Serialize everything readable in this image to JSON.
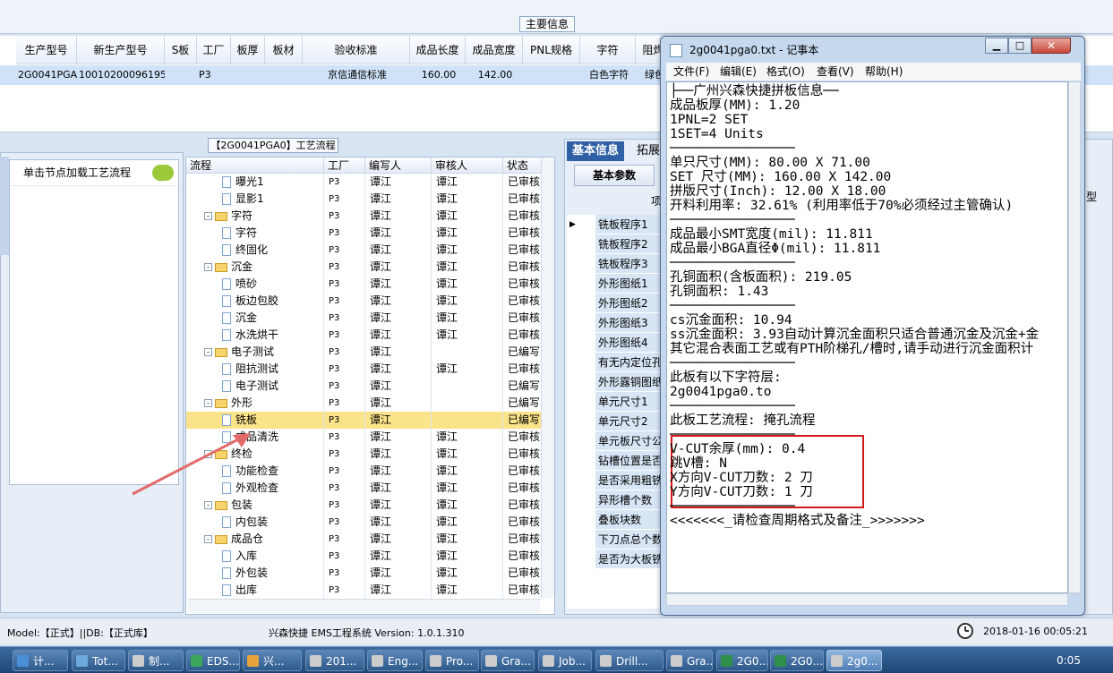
{
  "main_info": {
    "title": "主要信息",
    "columns": [
      "生产型号",
      "新生产型号",
      "S板",
      "工厂",
      "板厚",
      "板材",
      "验收标准",
      "成品长度",
      "成品宽度",
      "PNL规格",
      "字符",
      "阻焊"
    ],
    "row": [
      "2G0041PGA0",
      "10010200096195",
      "",
      "P3",
      "",
      "",
      "京信通信标准",
      "160.00",
      "142.00",
      "",
      "白色字符",
      "绿色"
    ]
  },
  "left_panel": {
    "load_button": "单击节点加载工艺流程"
  },
  "process": {
    "title": "【2G0041PGA0】工艺流程",
    "columns": [
      "流程",
      "工厂",
      "编写人",
      "审核人",
      "状态"
    ],
    "rows": [
      {
        "name": "曝光1",
        "level": 2,
        "factory": "P3",
        "writer": "谭江",
        "reviewer": "谭江",
        "status": "已审核"
      },
      {
        "name": "显影1",
        "level": 2,
        "factory": "P3",
        "writer": "谭江",
        "reviewer": "谭江",
        "status": "已审核"
      },
      {
        "name": "字符",
        "level": 1,
        "factory": "P3",
        "writer": "谭江",
        "reviewer": "谭江",
        "status": "已审核"
      },
      {
        "name": "字符",
        "level": 2,
        "factory": "P3",
        "writer": "谭江",
        "reviewer": "谭江",
        "status": "已审核"
      },
      {
        "name": "终固化",
        "level": 2,
        "factory": "P3",
        "writer": "谭江",
        "reviewer": "谭江",
        "status": "已审核"
      },
      {
        "name": "沉金",
        "level": 1,
        "factory": "P3",
        "writer": "谭江",
        "reviewer": "谭江",
        "status": "已审核"
      },
      {
        "name": "喷砂",
        "level": 2,
        "factory": "P3",
        "writer": "谭江",
        "reviewer": "谭江",
        "status": "已审核"
      },
      {
        "name": "板边包胶",
        "level": 2,
        "factory": "P3",
        "writer": "谭江",
        "reviewer": "谭江",
        "status": "已审核"
      },
      {
        "name": "沉金",
        "level": 2,
        "factory": "P3",
        "writer": "谭江",
        "reviewer": "谭江",
        "status": "已审核"
      },
      {
        "name": "水洗烘干",
        "level": 2,
        "factory": "P3",
        "writer": "谭江",
        "reviewer": "谭江",
        "status": "已审核"
      },
      {
        "name": "电子测试",
        "level": 1,
        "factory": "P3",
        "writer": "谭江",
        "reviewer": "",
        "status": "已编写"
      },
      {
        "name": "阻抗测试",
        "level": 2,
        "factory": "P3",
        "writer": "谭江",
        "reviewer": "谭江",
        "status": "已审核"
      },
      {
        "name": "电子测试",
        "level": 2,
        "factory": "P3",
        "writer": "谭江",
        "reviewer": "",
        "status": "已编写"
      },
      {
        "name": "外形",
        "level": 1,
        "factory": "P3",
        "writer": "谭江",
        "reviewer": "",
        "status": "已编写"
      },
      {
        "name": "铣板",
        "level": 2,
        "factory": "P3",
        "writer": "谭江",
        "reviewer": "",
        "status": "已编写",
        "selected": true
      },
      {
        "name": "成品清洗",
        "level": 2,
        "factory": "P3",
        "writer": "谭江",
        "reviewer": "谭江",
        "status": "已审核"
      },
      {
        "name": "终检",
        "level": 1,
        "factory": "P3",
        "writer": "谭江",
        "reviewer": "谭江",
        "status": "已审核"
      },
      {
        "name": "功能检查",
        "level": 2,
        "factory": "P3",
        "writer": "谭江",
        "reviewer": "谭江",
        "status": "已审核"
      },
      {
        "name": "外观检查",
        "level": 2,
        "factory": "P3",
        "writer": "谭江",
        "reviewer": "谭江",
        "status": "已审核"
      },
      {
        "name": "包装",
        "level": 1,
        "factory": "P3",
        "writer": "谭江",
        "reviewer": "谭江",
        "status": "已审核"
      },
      {
        "name": "内包装",
        "level": 2,
        "factory": "P3",
        "writer": "谭江",
        "reviewer": "谭江",
        "status": "已审核"
      },
      {
        "name": "成品仓",
        "level": 1,
        "factory": "P3",
        "writer": "谭江",
        "reviewer": "谭江",
        "status": "已审核"
      },
      {
        "name": "入库",
        "level": 2,
        "factory": "P3",
        "writer": "谭江",
        "reviewer": "谭江",
        "status": "已审核"
      },
      {
        "name": "外包装",
        "level": 2,
        "factory": "P3",
        "writer": "谭江",
        "reviewer": "谭江",
        "status": "已审核"
      },
      {
        "name": "出库",
        "level": 2,
        "factory": "P3",
        "writer": "谭江",
        "reviewer": "谭江",
        "status": "已审核"
      }
    ]
  },
  "right_panel": {
    "tabs": [
      "基本信息",
      "拓展"
    ],
    "sub_tab": "基本参数",
    "col_hint": "项",
    "type_hint": "型",
    "items": [
      "铣板程序1",
      "铣板程序2",
      "铣板程序3",
      "外形图纸1",
      "外形图纸2",
      "外形图纸3",
      "外形图纸4",
      "有无内定位孔",
      "外形露铜图纸",
      "单元尺寸1",
      "单元尺寸2",
      "单元板尺寸公",
      "钻槽位置是否",
      "是否采用粗铣",
      "异形槽个数",
      "叠板块数",
      "下刀点总个数",
      "是否为大板铣"
    ]
  },
  "notepad": {
    "title": "2g0041pga0.txt - 记事本",
    "menu": [
      "文件(F)",
      "编辑(E)",
      "格式(O)",
      "查看(V)",
      "帮助(H)"
    ],
    "lines": [
      "├──广州兴森快捷拼板信息──",
      "成品板厚(MM): 1.20",
      "1PNL=2 SET",
      "1SET=4 Units",
      "────────────────",
      "单只尺寸(MM): 80.00 X 71.00",
      "SET 尺寸(MM): 160.00 X 142.00",
      "拼版尺寸(Inch): 12.00 X 18.00",
      "开料利用率: 32.61% (利用率低于70%必须经过主管确认)",
      "────────────────",
      "成品最小SMT宽度(mil): 11.811",
      "成品最小BGA直径Φ(mil):  11.811",
      "────────────────",
      "孔铜面积(含板面积): 219.05",
      "孔铜面积: 1.43",
      "────────────────",
      "cs沉金面积: 10.94",
      "ss沉金面积: 3.93自动计算沉金面积只适合普通沉金及沉金+金",
      "其它混合表面工艺或有PTH阶梯孔/槽时,请手动进行沉金面积计",
      "────────────────",
      "此板有以下字符层:",
      "2g0041pga0.to",
      "────────────────",
      "此板工艺流程: 掩孔流程",
      "────────────────",
      "V-CUT余厚(mm): 0.4",
      "跳V槽: N",
      "X方向V-CUT刀数: 2 刀",
      "Y方向V-CUT刀数: 1 刀",
      "────────────────",
      "<<<<<<<_请检查周期格式及备注_>>>>>>>"
    ]
  },
  "status_bar": {
    "left": "Model:【正式】||DB:【正式库】",
    "center": "兴森快捷 EMS工程系统 Version: 1.0.1.310",
    "datetime": "2018-01-16 00:05:21"
  },
  "taskbar": {
    "items": [
      "计...",
      "Tot...",
      "制...",
      "EDS...",
      "兴...",
      "201...",
      "Eng...",
      "Pro...",
      "Gra...",
      "Job...",
      "Drill...",
      "Gra...",
      "2G0...",
      "2G0...",
      "2g0..."
    ],
    "clock": "0:05"
  },
  "colors": {
    "selected_row": "#fbe38a",
    "accent": "#2f5fa5",
    "highlight_box": "#d31b1b",
    "arrow": "#e46a6a"
  }
}
